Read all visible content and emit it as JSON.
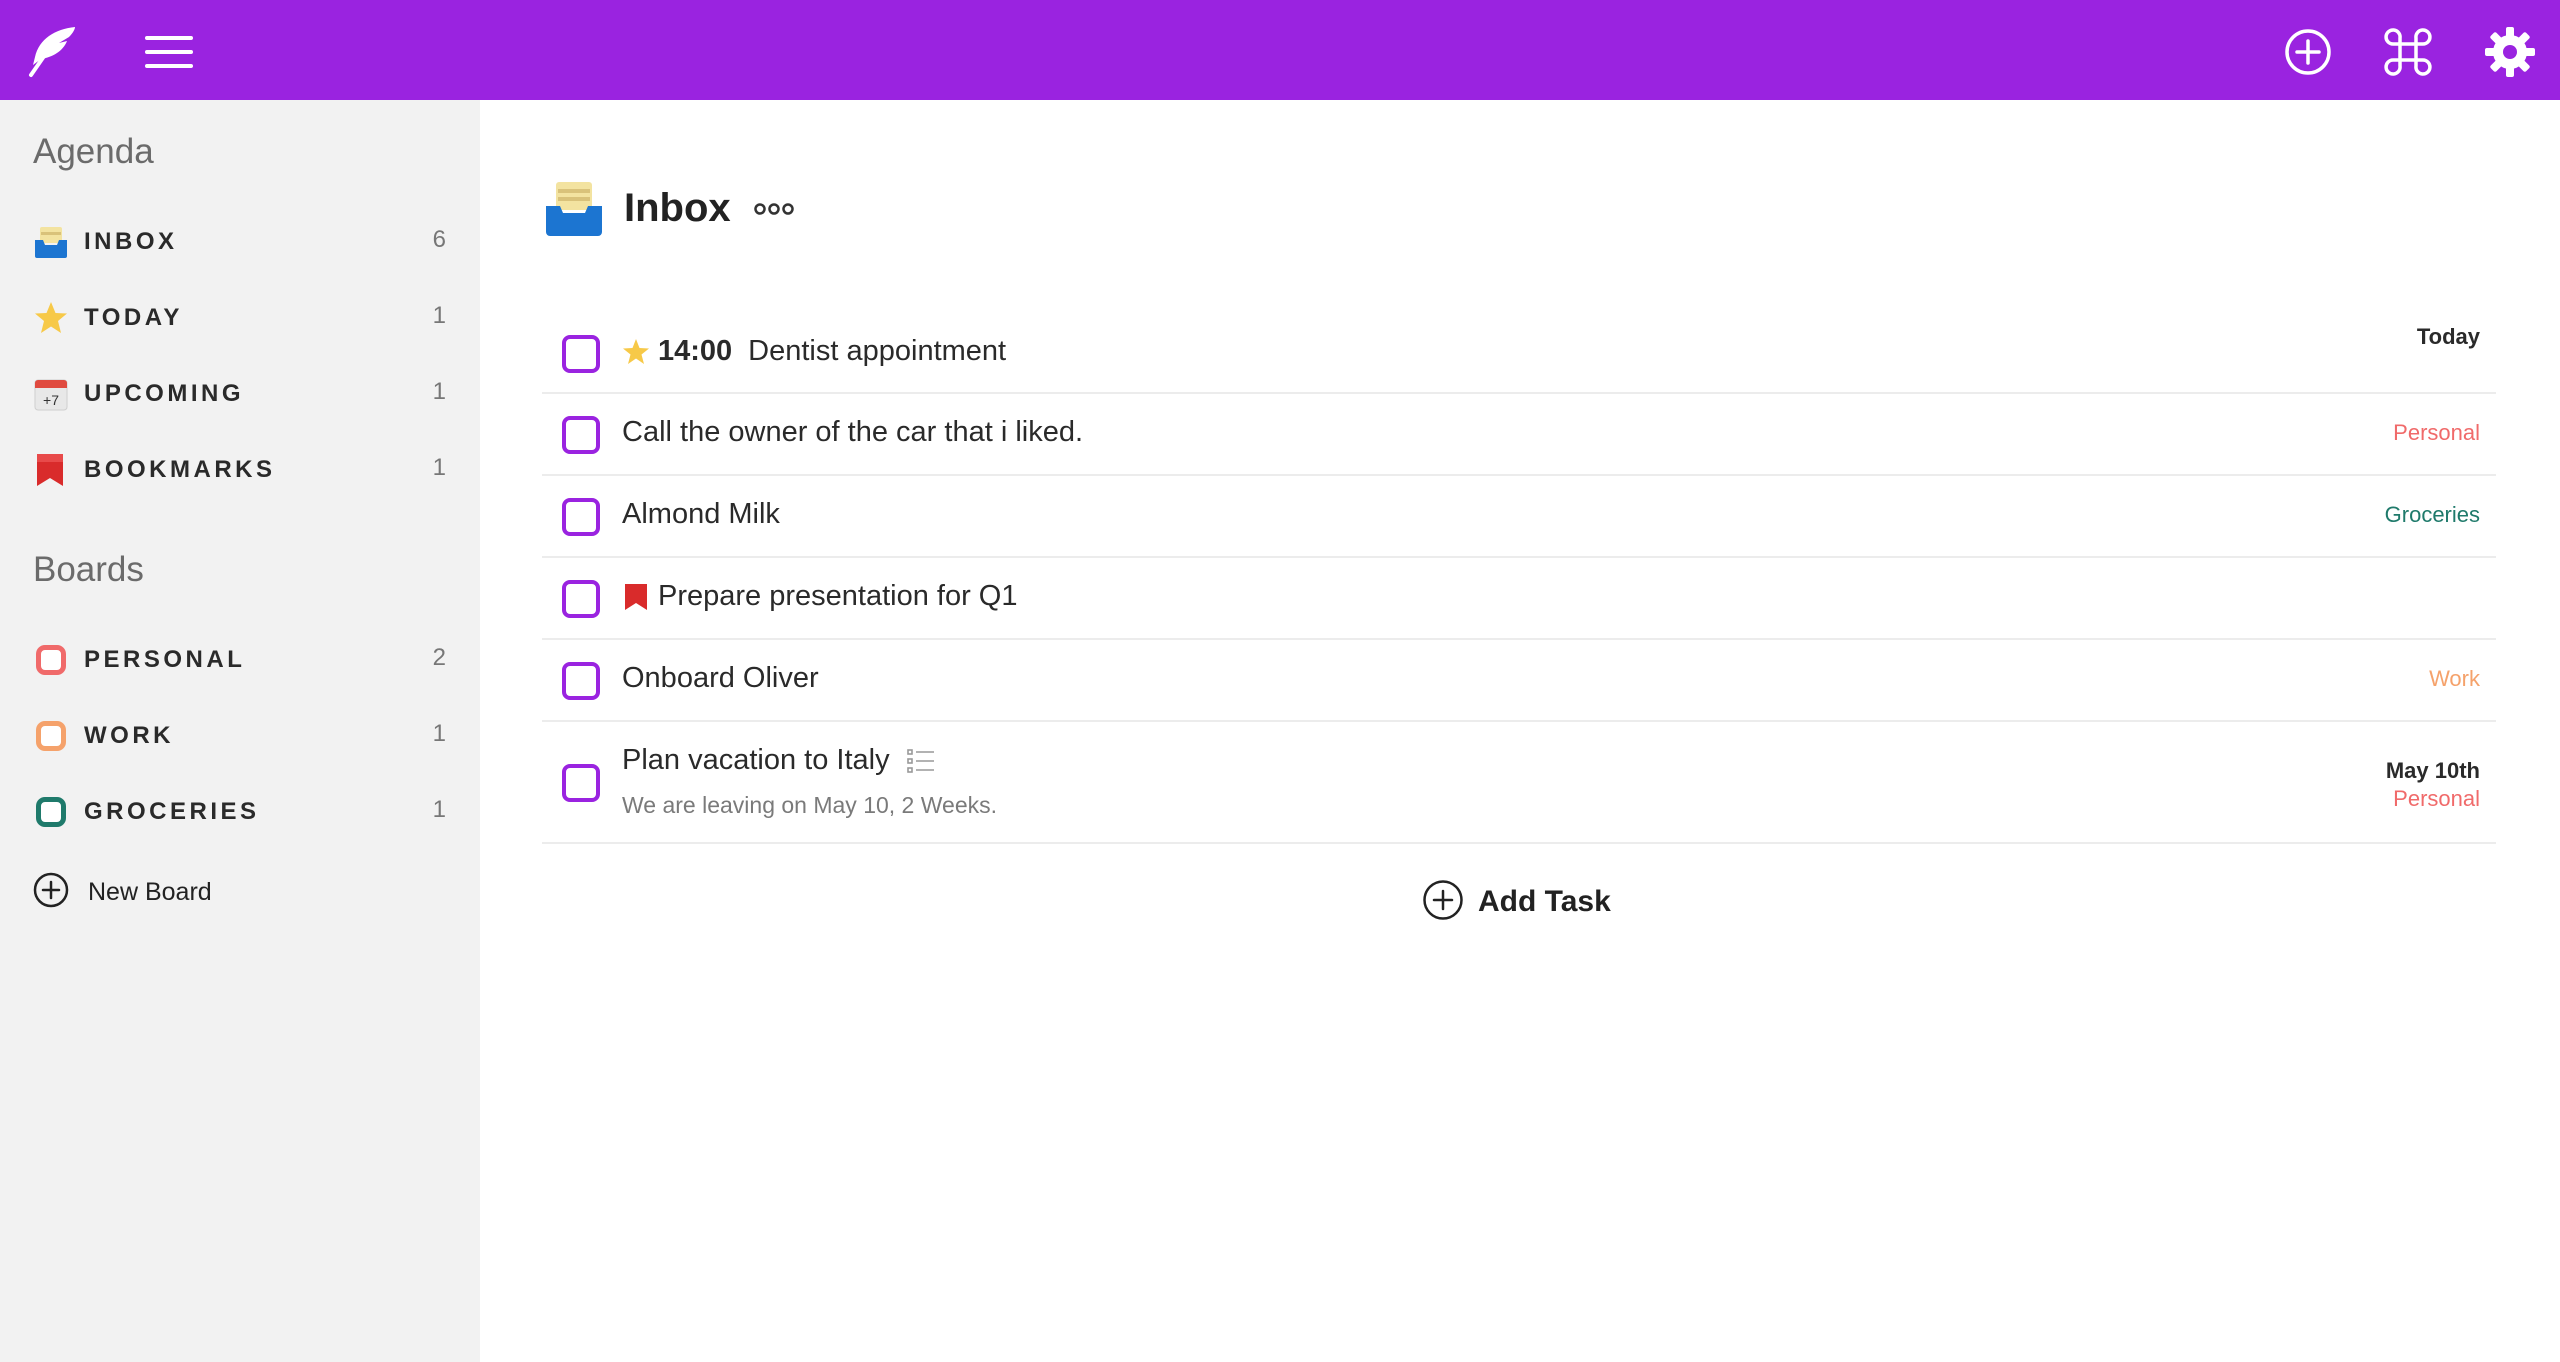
{
  "topbar": {
    "icons": [
      "feather-logo-icon",
      "hamburger-menu-icon",
      "add-circle-icon",
      "command-key-icon",
      "gear-icon"
    ],
    "color": "#9a23e0"
  },
  "sidebar": {
    "agenda_heading": "Agenda",
    "agenda_items": [
      {
        "label": "INBOX",
        "count": "6",
        "icon": "inbox-tray-icon"
      },
      {
        "label": "TODAY",
        "count": "1",
        "icon": "star-icon"
      },
      {
        "label": "UPCOMING",
        "count": "1",
        "icon": "calendar-icon",
        "calendar_text": "+7"
      },
      {
        "label": "BOOKMARKS",
        "count": "1",
        "icon": "bookmark-icon"
      }
    ],
    "boards_heading": "Boards",
    "board_items": [
      {
        "label": "PERSONAL",
        "count": "2",
        "color": "#f06a6a"
      },
      {
        "label": "WORK",
        "count": "1",
        "color": "#f5a26b"
      },
      {
        "label": "GROCERIES",
        "count": "1",
        "color": "#1f7a6b"
      }
    ],
    "new_board_label": "New Board"
  },
  "main": {
    "title": "Inbox",
    "title_icon": "inbox-tray-icon",
    "more_icon": "ellipsis-icon",
    "tasks": [
      {
        "time": "14:00",
        "text": "Dentist appointment",
        "icon": "star-icon",
        "date": "Today",
        "board": ""
      },
      {
        "text": "Call the owner of the car that i liked.",
        "board": "Personal",
        "board_color": "#f06a6a"
      },
      {
        "text": "Almond Milk",
        "board": "Groceries",
        "board_color": "#1f7a6b"
      },
      {
        "text": "Prepare presentation for Q1",
        "icon": "bookmark-icon",
        "board": ""
      },
      {
        "text": "Onboard Oliver",
        "board": "Work",
        "board_color": "#f5a26b"
      },
      {
        "text": "Plan vacation to Italy",
        "icon_after": "checklist-icon",
        "note": "We are leaving on May 10, 2 Weeks.",
        "date": "May 10th",
        "board": "Personal",
        "board_color": "#f06a6a"
      }
    ],
    "add_task_label": "Add Task"
  }
}
